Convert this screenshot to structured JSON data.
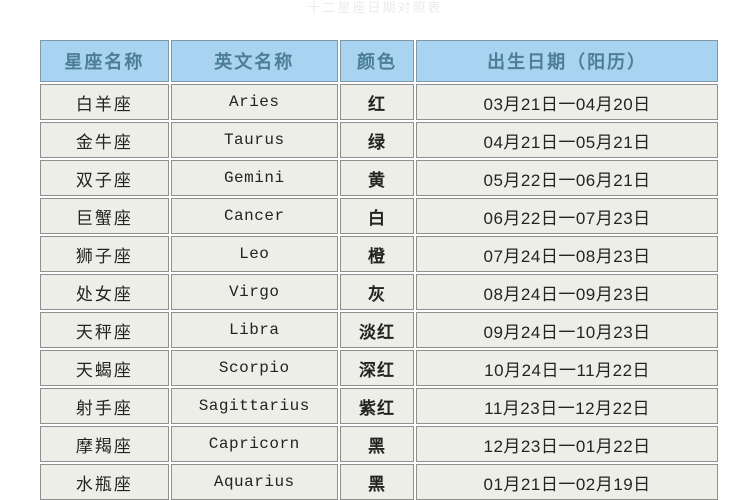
{
  "page": {
    "ghost_caption": "十二星座日期对照表"
  },
  "table": {
    "headers": [
      {
        "label": "星座名称",
        "key": "cn_name"
      },
      {
        "label": "英文名称",
        "key": "en_name"
      },
      {
        "label": "颜色",
        "key": "color"
      },
      {
        "label": "出生日期（阳历）",
        "key": "date_range"
      }
    ],
    "rows": [
      {
        "cn_name": "白羊座",
        "en_name": "Aries",
        "color": "红",
        "date_range": "03月21日一04月20日"
      },
      {
        "cn_name": "金牛座",
        "en_name": "Taurus",
        "color": "绿",
        "date_range": "04月21日一05月21日"
      },
      {
        "cn_name": "双子座",
        "en_name": "Gemini",
        "color": "黄",
        "date_range": "05月22日一06月21日"
      },
      {
        "cn_name": "巨蟹座",
        "en_name": "Cancer",
        "color": "白",
        "date_range": "06月22日一07月23日"
      },
      {
        "cn_name": "狮子座",
        "en_name": "Leo",
        "color": "橙",
        "date_range": "07月24日一08月23日"
      },
      {
        "cn_name": "处女座",
        "en_name": "Virgo",
        "color": "灰",
        "date_range": "08月24日一09月23日"
      },
      {
        "cn_name": "天秤座",
        "en_name": "Libra",
        "color": "淡红",
        "date_range": "09月24日一10月23日"
      },
      {
        "cn_name": "天蝎座",
        "en_name": "Scorpio",
        "color": "深红",
        "date_range": "10月24日一11月22日"
      },
      {
        "cn_name": "射手座",
        "en_name": "Sagittarius",
        "color": "紫红",
        "date_range": "11月23日一12月22日"
      },
      {
        "cn_name": "摩羯座",
        "en_name": "Capricorn",
        "color": "黑",
        "date_range": "12月23日一01月22日"
      },
      {
        "cn_name": "水瓶座",
        "en_name": "Aquarius",
        "color": "黑",
        "date_range": "01月21日一02月19日"
      }
    ]
  },
  "colors": {
    "header_fill": "#a9d7f5",
    "header_text": "#4a7f96",
    "cell_fill": "#f1f1ec",
    "cell_text": "#20211f",
    "border": "#8d918f",
    "page_background": "#ffffff"
  }
}
